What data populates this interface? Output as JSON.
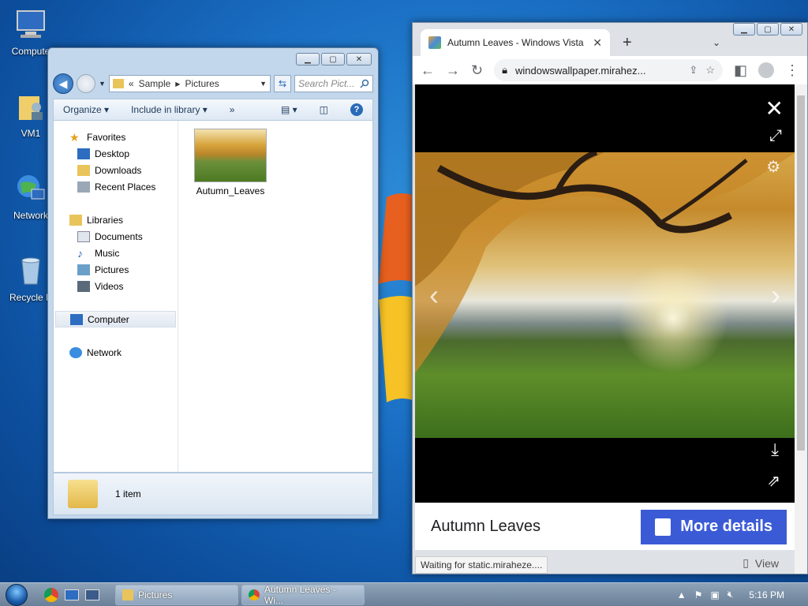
{
  "desktop": {
    "icons": [
      {
        "label": "Compute"
      },
      {
        "label": "VM1"
      },
      {
        "label": "Network"
      },
      {
        "label": "Recycle B"
      }
    ]
  },
  "explorer": {
    "breadcrumb": {
      "prefix": "«",
      "parts": [
        "Sample",
        "Pictures"
      ]
    },
    "search_placeholder": "Search Pict...",
    "toolbar": {
      "organize": "Organize",
      "include": "Include in library",
      "more": "»"
    },
    "nav": {
      "favorites": "Favorites",
      "desktop": "Desktop",
      "downloads": "Downloads",
      "recent": "Recent Places",
      "libraries": "Libraries",
      "documents": "Documents",
      "music": "Music",
      "pictures": "Pictures",
      "videos": "Videos",
      "computer": "Computer",
      "network": "Network"
    },
    "files": [
      {
        "name": "Autumn_Leaves"
      }
    ],
    "status": "1 item"
  },
  "chrome": {
    "tab_title": "Autumn Leaves - Windows Vista",
    "url": "windowswallpaper.mirahez...",
    "caption": "Autumn Leaves",
    "more_details": "More details",
    "status_bubble": "Waiting for static.miraheze....",
    "view_label": "View"
  },
  "taskbar": {
    "pictures": "Pictures",
    "chrome": "Autumn Leaves - Wi...",
    "clock": "5:16 PM"
  }
}
